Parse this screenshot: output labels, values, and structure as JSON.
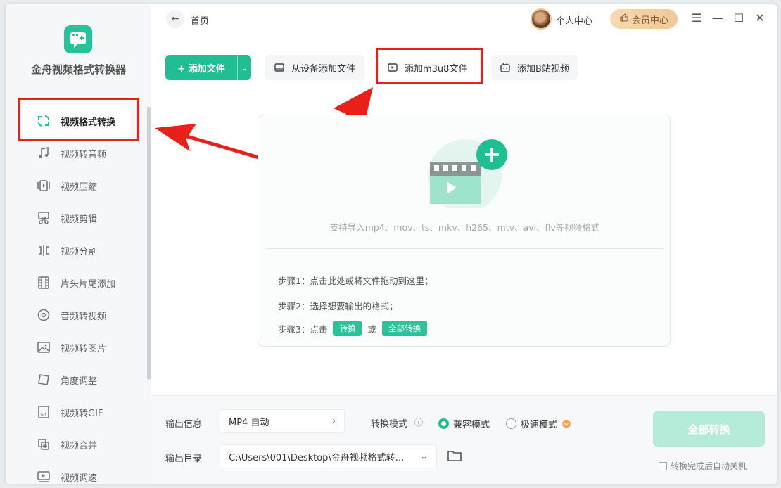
{
  "app": {
    "name": "金舟视频格式转换器"
  },
  "topbar": {
    "breadcrumb": "首页",
    "personal_center": "个人中心",
    "vip_center": "会员中心"
  },
  "sidebar": {
    "items": [
      {
        "label": "视频格式转换",
        "icon": "convert-icon",
        "active": true
      },
      {
        "label": "视频转音频",
        "icon": "music-note-icon"
      },
      {
        "label": "视频压缩",
        "icon": "compress-icon"
      },
      {
        "label": "视频剪辑",
        "icon": "scissors-icon"
      },
      {
        "label": "视频分割",
        "icon": "split-icon"
      },
      {
        "label": "片头片尾添加",
        "icon": "film-icon"
      },
      {
        "label": "音频转视频",
        "icon": "disc-icon"
      },
      {
        "label": "视频转图片",
        "icon": "image-icon"
      },
      {
        "label": "角度调整",
        "icon": "rotate-icon"
      },
      {
        "label": "视频转GIF",
        "icon": "gif-icon"
      },
      {
        "label": "视频合并",
        "icon": "merge-icon"
      },
      {
        "label": "视频调速",
        "icon": "speed-icon"
      }
    ]
  },
  "toolbar": {
    "add_file": "添加文件",
    "add_from_device": "从设备添加文件",
    "add_m3u8": "添加m3u8文件",
    "add_bilibili": "添加B站视频"
  },
  "dropzone": {
    "support_text": "支持导入mp4、mov、ts、mkv、h265、mtv、avi、flv等视频格式",
    "step1": "步骤1：点击此处或将文件拖动到这里；",
    "step2": "步骤2：选择想要输出的格式；",
    "step3_prefix": "步骤3：点击",
    "step3_chip1": "转换",
    "step3_or": "或",
    "step3_chip2": "全部转换"
  },
  "output": {
    "info_label": "输出信息",
    "format_value": "MP4 自动",
    "dir_label": "输出目录",
    "dir_value": "C:\\Users\\001\\Desktop\\金舟视频格式转...",
    "mode_label": "转换模式",
    "mode_compat": "兼容模式",
    "mode_fast": "极速模式",
    "convert_all": "全部转换",
    "auto_shutdown": "转换完成后自动关机"
  },
  "colors": {
    "accent": "#1fbf93",
    "annotation_red": "#e8201a"
  }
}
